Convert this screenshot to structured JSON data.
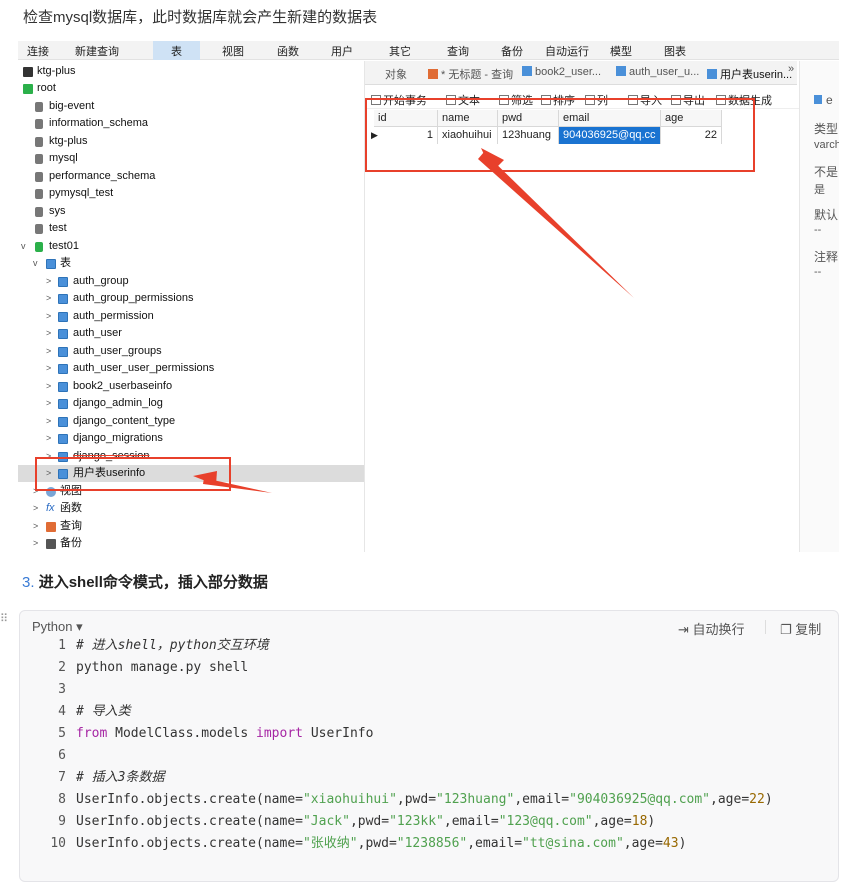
{
  "intro_text": "检查mysql数据库，此时数据库就会产生新建的数据表",
  "menubar": [
    "连接",
    "新建查询",
    "表",
    "视图",
    "函数",
    "用户",
    "其它",
    "查询",
    "备份",
    "自动运行",
    "模型",
    "图表"
  ],
  "tree": {
    "connections": [
      {
        "label": "ktg-plus"
      },
      {
        "label": "root"
      }
    ],
    "databases": [
      "big-event",
      "information_schema",
      "ktg-plus",
      "mysql",
      "performance_schema",
      "pymysql_test",
      "sys",
      "test",
      "test01"
    ],
    "tables_folder": "表",
    "tables": [
      "auth_group",
      "auth_group_permissions",
      "auth_permission",
      "auth_user",
      "auth_user_groups",
      "auth_user_user_permissions",
      "book2_userbaseinfo",
      "django_admin_log",
      "django_content_type",
      "django_migrations",
      "django_session",
      "用户表userinfo"
    ],
    "other_folders": [
      "视图",
      "函数",
      "查询",
      "备份"
    ]
  },
  "tabs": [
    "对象",
    "* 无标题 - 查询",
    "book2_user...",
    "auth_user_u...",
    "用户表userin...",
    "»"
  ],
  "toolbar": [
    "开始事务",
    "文本",
    "筛选",
    "排序",
    "列",
    "导入",
    "导出",
    "数据生成"
  ],
  "grid": {
    "columns": [
      "id",
      "name",
      "pwd",
      "email",
      "age"
    ],
    "rows": [
      {
        "id": "1",
        "name": "xiaohuihui",
        "pwd": "123huang",
        "email": "904036925@qq.cc",
        "age": "22"
      }
    ]
  },
  "props": {
    "head": "e",
    "items": [
      {
        "label": "类型",
        "value": "varch"
      },
      {
        "label": "不是",
        "value": "是"
      },
      {
        "label": "默认",
        "value": "--"
      },
      {
        "label": "注释",
        "value": "--"
      }
    ]
  },
  "step": {
    "number": "3.",
    "title": "进入shell命令模式，插入部分数据"
  },
  "code_block": {
    "language": "Python ▾",
    "wrap_label": "自动换行",
    "copy_label": "复制",
    "line_numbers": [
      "1",
      "2",
      "3",
      "4",
      "5",
      "6",
      "7",
      "8",
      "9",
      "10"
    ],
    "lines": [
      "# 进入shell，python交互环境",
      "python manage.py shell",
      "",
      "# 导入类",
      "from ModelClass.models import UserInfo",
      "",
      "# 插入3条数据",
      "UserInfo.objects.create(name=\"xiaohuihui\",pwd=\"123huang\",email=\"904036925@qq.com\",age=22)",
      "UserInfo.objects.create(name=\"Jack\",pwd=\"123kk\",email=\"123@qq.com\",age=18)",
      "UserInfo.objects.create(name=\"张收纳\",pwd=\"1238856\",email=\"tt@sina.com\",age=43)"
    ]
  },
  "colors": {
    "accent": "#1a73d1",
    "annotation_red": "#e8402b",
    "comment": "#a0a1a7",
    "keyword": "#a626a4",
    "string": "#50a14f",
    "number": "#986801"
  }
}
